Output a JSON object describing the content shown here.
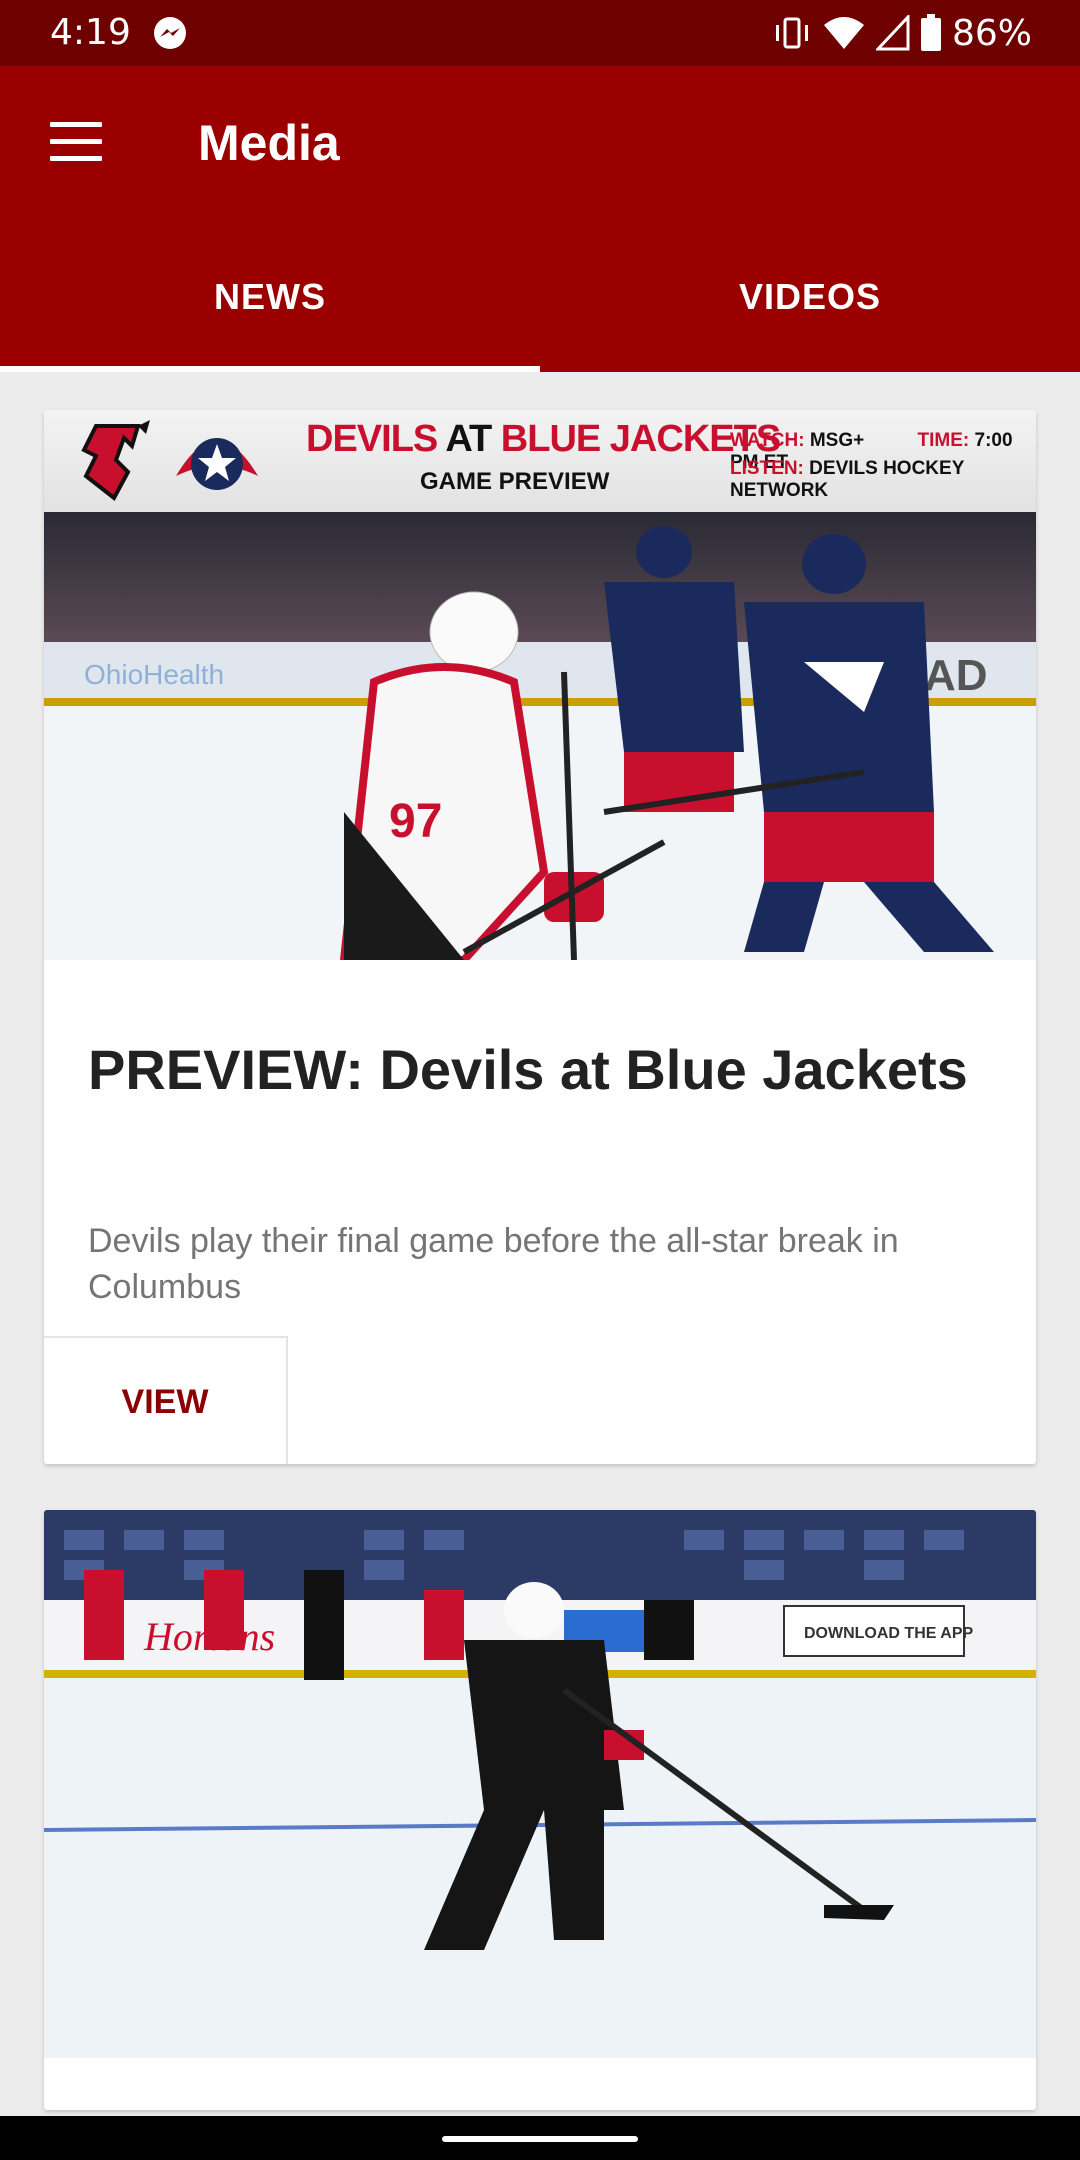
{
  "status_bar": {
    "time": "4:19",
    "battery": "86%",
    "icons": [
      "messenger-icon",
      "vibrate-icon",
      "wifi-icon",
      "signal-icon",
      "battery-icon"
    ]
  },
  "app_bar": {
    "title": "Media",
    "menu_icon": "hamburger-menu-icon"
  },
  "tabs": [
    {
      "label": "NEWS",
      "selected": true
    },
    {
      "label": "VIDEOS",
      "selected": false
    }
  ],
  "articles": [
    {
      "banner": {
        "headline_part1": "DEVILS",
        "headline_at": " AT ",
        "headline_part2": "BLUE JACKETS",
        "subtitle": "GAME PREVIEW",
        "watch_label": "WATCH:",
        "watch_value": "MSG+",
        "time_label": "TIME:",
        "time_value": "7:00 PM ET",
        "listen_label": "LISTEN:",
        "listen_value": "DEVILS HOCKEY NETWORK"
      },
      "photo": {
        "jersey_number": "97"
      },
      "title": "PREVIEW: Devils at Blue Jackets",
      "description": "Devils play their final game before the all-star break in Columbus",
      "action_label": "VIEW"
    },
    {
      "photo": {
        "board_text": "DOWNLOAD THE APP"
      }
    }
  ],
  "colors": {
    "primary": "#9b0000",
    "status_bar": "#6e0000",
    "accent_text": "#8b0000",
    "devils_red": "#c8102e",
    "jackets_navy": "#1b2a5c"
  }
}
